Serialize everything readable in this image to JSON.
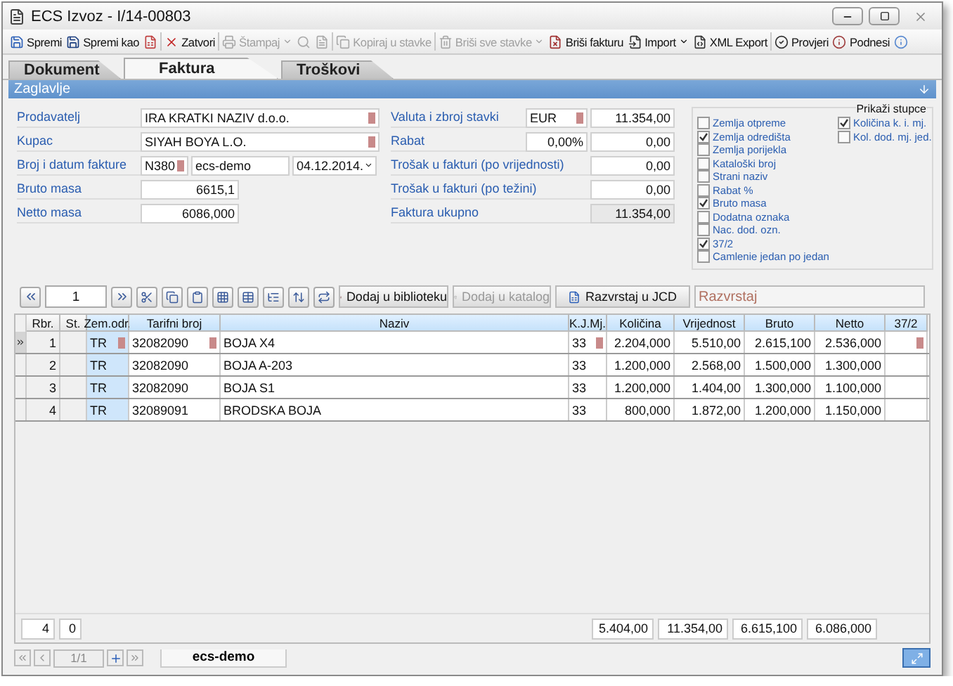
{
  "window": {
    "title": "ECS Izvoz - I/14-00803"
  },
  "toolbar": [
    {
      "label": "Spremi",
      "disabled": false,
      "dropdown": false
    },
    {
      "label": "Spremi kao",
      "disabled": false,
      "dropdown": false
    },
    {
      "disabled": false,
      "dropdown": false
    },
    {
      "label": "Zatvori",
      "disabled": false,
      "dropdown": false
    },
    {
      "label": "Štampaj",
      "disabled": true,
      "dropdown": true
    },
    {
      "disabled": true,
      "dropdown": false
    },
    {
      "disabled": true,
      "dropdown": false
    },
    {
      "label": "Kopiraj u stavke",
      "disabled": true,
      "dropdown": false
    },
    {
      "label": "Briši sve stavke",
      "disabled": true,
      "dropdown": true
    },
    {
      "label": "Briši fakturu",
      "disabled": false,
      "dropdown": false
    },
    {
      "label": "Import",
      "disabled": false,
      "dropdown": true
    },
    {
      "label": "XML Export",
      "disabled": false,
      "dropdown": false
    },
    {
      "label": "Provjeri",
      "disabled": false,
      "dropdown": false
    },
    {
      "label": "Podnesi",
      "disabled": false,
      "dropdown": false
    },
    {
      "disabled": false,
      "dropdown": false
    }
  ],
  "tabs": [
    {
      "label": "Dokument",
      "selected": false
    },
    {
      "label": "Faktura",
      "selected": true
    },
    {
      "label": "Troškovi",
      "selected": false
    }
  ],
  "section": {
    "title": "Zaglavlje"
  },
  "left_fields": [
    {
      "label": "Prodavatelj",
      "kind": "wide",
      "value": "IRA KRATKI NAZIV d.o.o.",
      "flag": true
    },
    {
      "label": "Kupac",
      "kind": "wide",
      "value": "SIYAH BOYA L.O.",
      "flag": true
    },
    {
      "label": "Broj i datum fakture",
      "kind": "triple",
      "value": "N380",
      "flag": true,
      "value2": "ecs-demo",
      "date": "04.12.2014."
    },
    {
      "label": "Bruto masa",
      "kind": "number",
      "value": "6615,1"
    },
    {
      "label": "Netto masa",
      "kind": "number",
      "value": "6086,000"
    }
  ],
  "right_fields": [
    {
      "label": "Valuta i zbroj stavki",
      "kind": "pair",
      "value": "EUR",
      "flag": true,
      "amount": "11.354,00"
    },
    {
      "label": "Rabat",
      "kind": "pair",
      "value": "0,00%",
      "flag": false,
      "amount": "0,00"
    },
    {
      "label": "Trošak u fakturi (po vrijednosti)",
      "kind": "amount",
      "amount": "0,00"
    },
    {
      "label": "Trošak u fakturi (po težini)",
      "kind": "amount",
      "amount": "0,00"
    },
    {
      "label": "Faktura ukupno",
      "kind": "total",
      "amount": "11.354,00"
    }
  ],
  "columns_panel": {
    "title": "Prikaži stupce",
    "left": [
      {
        "label": "Zemlja otpreme",
        "checked": false
      },
      {
        "label": "Zemlja odredišta",
        "checked": true
      },
      {
        "label": "Zemlja porijekla",
        "checked": false
      },
      {
        "label": "Kataloški broj",
        "checked": false
      },
      {
        "label": "Strani naziv",
        "checked": false
      },
      {
        "label": "Rabat %",
        "checked": false
      },
      {
        "label": "Bruto masa",
        "checked": true
      },
      {
        "label": "Dodatna oznaka",
        "checked": false
      },
      {
        "label": "Nac. dod. ozn.",
        "checked": false
      },
      {
        "label": "37/2",
        "checked": true
      },
      {
        "label": "Camlenie jedan po jedan",
        "checked": false
      }
    ],
    "right": [
      {
        "label": "Količina k. i. mj.",
        "checked": true
      },
      {
        "label": "Kol. dod. mj. jed.",
        "checked": false
      }
    ]
  },
  "grid_toolbar": {
    "page": "1",
    "buttons": [
      {
        "label": "Dodaj u biblioteku",
        "disabled": false
      },
      {
        "label": "Dodaj u katalog",
        "disabled": true
      },
      {
        "label": "Razvrstaj u JCD",
        "disabled": false
      }
    ],
    "filter_placeholder": "Razvrstaj"
  },
  "table": {
    "columns": [
      "Rbr.",
      "St.",
      "Zem.odr.",
      "Tarifni broj",
      "Naziv",
      "K.J.Mj.",
      "Količina",
      "Vrijednost",
      "Bruto",
      "Netto",
      "37/2"
    ],
    "rows": [
      {
        "current": true,
        "flagged": true,
        "cells": [
          "1",
          "",
          "TR",
          "32082090",
          "BOJA X4",
          "33",
          "2.204,000",
          "5.510,00",
          "2.615,100",
          "2.536,000",
          ""
        ]
      },
      {
        "current": false,
        "flagged": false,
        "cells": [
          "2",
          "",
          "TR",
          "32082090",
          "BOJA A-203",
          "33",
          "1.200,000",
          "2.568,00",
          "1.500,000",
          "1.300,000",
          ""
        ]
      },
      {
        "current": false,
        "flagged": false,
        "cells": [
          "3",
          "",
          "TR",
          "32082090",
          "BOJA S1",
          "33",
          "1.200,000",
          "1.404,00",
          "1.300,000",
          "1.100,000",
          ""
        ]
      },
      {
        "current": false,
        "flagged": false,
        "cells": [
          "4",
          "",
          "TR",
          "32089091",
          "BRODSKA BOJA",
          "33",
          "800,000",
          "1.872,00",
          "1.200,000",
          "1.150,000",
          ""
        ]
      }
    ]
  },
  "footer": {
    "count": "4",
    "status": "0",
    "totals": [
      "5.404,00",
      "11.354,00",
      "6.615,100",
      "6.086,000"
    ]
  },
  "navigator": {
    "page": "1/1",
    "tab": "ecs-demo"
  }
}
